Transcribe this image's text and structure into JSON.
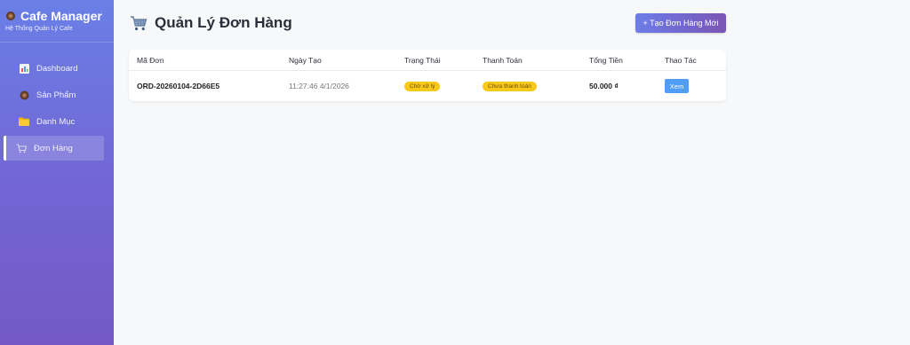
{
  "sidebar": {
    "title": "Cafe Manager",
    "subtitle": "Hệ Thống Quản Lý Cafe",
    "items": [
      {
        "label": "Dashboard",
        "icon": "chart-icon"
      },
      {
        "label": "Sản Phẩm",
        "icon": "coffee-icon"
      },
      {
        "label": "Danh Mục",
        "icon": "folder-icon"
      },
      {
        "label": "Đơn Hàng",
        "icon": "cart-icon",
        "active": true
      }
    ]
  },
  "header": {
    "title": "Quản Lý Đơn Hàng",
    "create_button": "+ Tạo Đơn Hàng Mới"
  },
  "table": {
    "columns": [
      "Mã Đơn",
      "Ngày Tạo",
      "Trạng Thái",
      "Thanh Toán",
      "Tổng Tiền",
      "Thao Tác"
    ],
    "rows": [
      {
        "code": "ORD-20260104-2D66E5",
        "date": "11:27:46 4/1/2026",
        "status": "Chờ xử lý",
        "payment": "Chưa thanh toán",
        "total": "50.000 ₫",
        "action": "Xem"
      }
    ]
  },
  "colors": {
    "sidebar_top": "#6a7fe6",
    "sidebar_bottom": "#7459c6",
    "badge": "#f8c91b",
    "view_button": "#4f9df5"
  }
}
